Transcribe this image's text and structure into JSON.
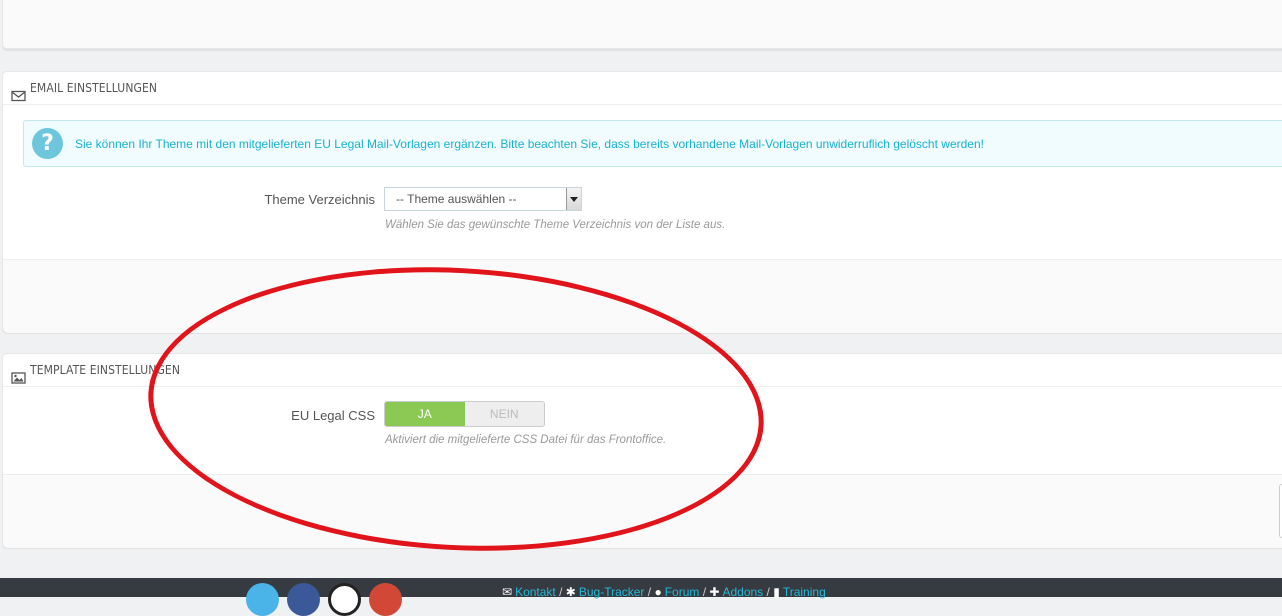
{
  "email_panel": {
    "heading": "EMAIL EINSTELLUNGEN",
    "heading_icon": "envelope-icon",
    "info_text": "Sie können Ihr Theme mit den mitgelieferten EU Legal Mail-Vorlagen ergänzen. Bitte beachten Sie, dass bereits vorhandene Mail-Vorlagen unwiderruflich gelöscht werden!",
    "info_icon": "question-icon",
    "theme_label": "Theme Verzeichnis",
    "theme_select_value": "-- Theme auswählen --",
    "theme_help": "Wählen Sie das gewünschte Theme Verzeichnis von der Liste aus."
  },
  "template_panel": {
    "heading": "TEMPLATE EINSTELLUNGEN",
    "heading_icon": "image-icon",
    "css_label": "EU Legal CSS",
    "toggle_yes": "JA",
    "toggle_no": "NEIN",
    "toggle_selected": "JA",
    "css_help": "Aktiviert die mitgelieferte CSS Datei für das Frontoffice."
  },
  "annotation": {
    "color": "#e0141a"
  },
  "footer": {
    "social": [
      {
        "name": "twitter-icon",
        "color": "#4ab3e7"
      },
      {
        "name": "facebook-icon",
        "color": "#3b5998"
      },
      {
        "name": "github-icon",
        "color": "#ffffff"
      },
      {
        "name": "google-plus-icon",
        "color": "#d14836"
      }
    ],
    "links": [
      {
        "label": "Kontakt",
        "icon": "envelope-icon"
      },
      {
        "label": "Bug-Tracker",
        "icon": "bug-icon"
      },
      {
        "label": "Forum",
        "icon": "comments-icon"
      },
      {
        "label": "Addons",
        "icon": "puzzle-icon"
      },
      {
        "label": "Training",
        "icon": "book-icon"
      }
    ],
    "separator": "/"
  },
  "colors": {
    "info_text": "#1ab1d3",
    "toggle_on": "#8bc954",
    "footer_bg": "#363a41",
    "link": "#25b9d7"
  }
}
